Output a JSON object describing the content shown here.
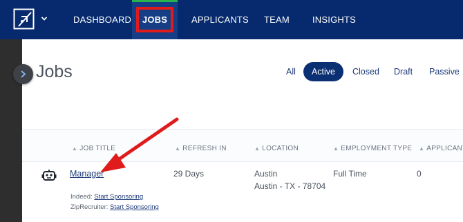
{
  "nav": {
    "items": [
      {
        "label": "DASHBOARD"
      },
      {
        "label": "JOBS",
        "active": true
      },
      {
        "label": "APPLICANTS"
      },
      {
        "label": "TEAM"
      },
      {
        "label": "INSIGHTS"
      }
    ]
  },
  "page": {
    "title": "Jobs",
    "filters": [
      "All",
      "Active",
      "Closed",
      "Draft",
      "Passive"
    ],
    "selected_filter": "Active"
  },
  "table": {
    "headers": {
      "title": "JOB TITLE",
      "refresh": "REFRESH IN",
      "location": "LOCATION",
      "employment_type": "EMPLOYMENT TYPE",
      "applicants": "APPLICANT"
    },
    "rows": [
      {
        "title": "Manager",
        "refresh_in": "29 Days",
        "city": "Austin",
        "address": "Austin - TX - 78704",
        "employment_type": "Full Time",
        "applicants": "0",
        "sponsor": [
          {
            "board": "Indeed:",
            "action": "Start Sponsoring"
          },
          {
            "board": "ZipRecruiter:",
            "action": "Start Sponsoring"
          }
        ]
      }
    ]
  },
  "colors": {
    "nav_bg": "#062a6d",
    "active_tab_bg": "#163e86",
    "active_tab_indicator": "#27b34b",
    "highlight_box": "#e01b1b",
    "active_filter_bg": "#0b2f73",
    "link": "#1d3a78"
  },
  "icons": {
    "logo": "logo-icon",
    "caret": "chevron-down-icon",
    "sidebar_toggle": "chevron-right-icon",
    "job_row": "robot-icon",
    "sort": "sort-icon"
  }
}
